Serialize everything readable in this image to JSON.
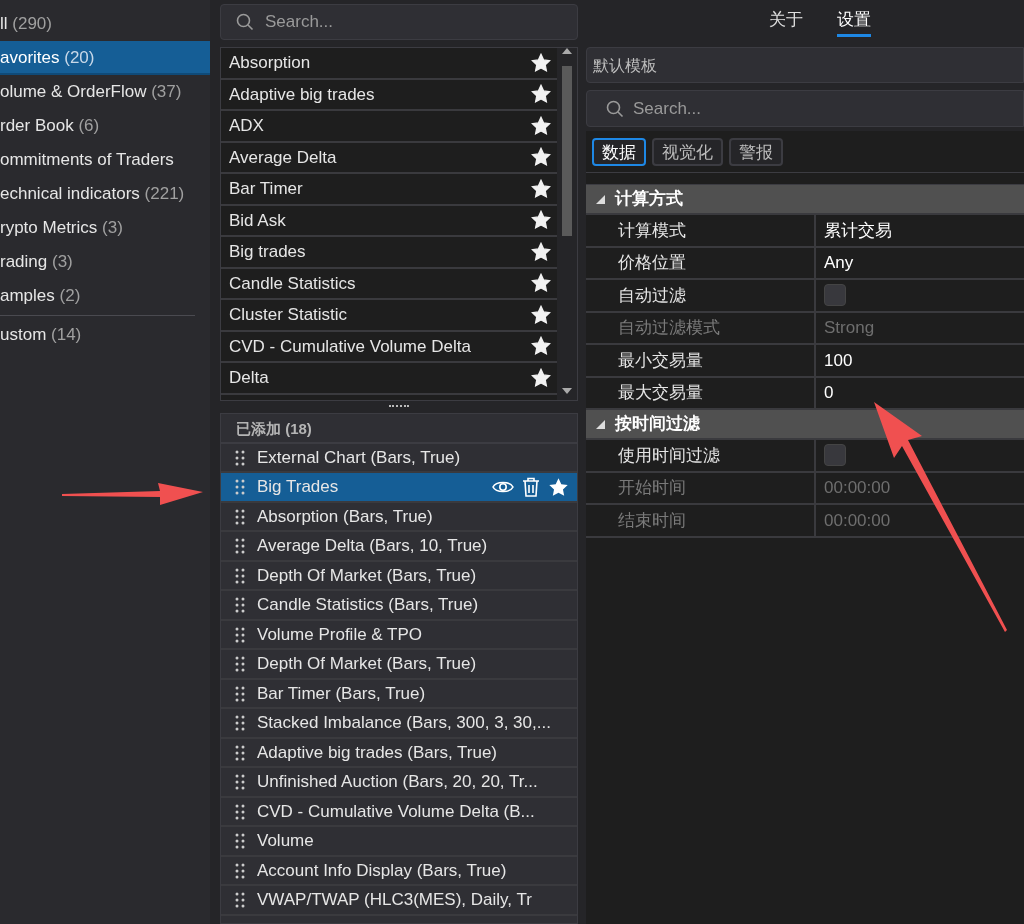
{
  "categories": [
    {
      "label": "ll",
      "count": "(290)",
      "selected": false
    },
    {
      "label": "avorites",
      "count": "(20)",
      "selected": true
    },
    {
      "label": "olume & OrderFlow",
      "count": "(37)",
      "selected": false
    },
    {
      "label": "rder Book",
      "count": "(6)",
      "selected": false
    },
    {
      "label": "ommitments of Traders",
      "selected": false
    },
    {
      "label": "echnical indicators",
      "count": "(221)",
      "selected": false
    },
    {
      "label": "rypto Metrics",
      "count": "(3)",
      "selected": false
    },
    {
      "label": "rading",
      "count": "(3)",
      "selected": false
    },
    {
      "label": "amples",
      "count": "(2)",
      "selected": false
    },
    {
      "label": "ustom",
      "count": "(14)",
      "selected": false
    }
  ],
  "indicator_search": {
    "placeholder": "Search..."
  },
  "indicators": [
    {
      "name": "Absorption",
      "favorite": true
    },
    {
      "name": "Adaptive big trades",
      "favorite": true
    },
    {
      "name": "ADX",
      "favorite": true
    },
    {
      "name": "Average Delta",
      "favorite": true
    },
    {
      "name": "Bar Timer",
      "favorite": true
    },
    {
      "name": "Bid Ask",
      "favorite": true
    },
    {
      "name": "Big trades",
      "favorite": true
    },
    {
      "name": "Candle Statistics",
      "favorite": true
    },
    {
      "name": "Cluster Statistic",
      "favorite": true
    },
    {
      "name": "CVD - Cumulative Volume Delta",
      "favorite": true
    },
    {
      "name": "Delta",
      "favorite": true
    }
  ],
  "added": {
    "title": "已添加 (18)",
    "items": [
      {
        "name": "External Chart (Bars, True)",
        "selected": false
      },
      {
        "name": "Big Trades",
        "selected": true
      },
      {
        "name": "Absorption (Bars, True)",
        "selected": false
      },
      {
        "name": "Average Delta (Bars, 10, True)",
        "selected": false
      },
      {
        "name": "Depth Of Market (Bars, True)",
        "selected": false
      },
      {
        "name": "Candle Statistics (Bars, True)",
        "selected": false
      },
      {
        "name": "Volume Profile & TPO",
        "selected": false
      },
      {
        "name": "Depth Of Market (Bars, True)",
        "selected": false
      },
      {
        "name": "Bar Timer (Bars, True)",
        "selected": false
      },
      {
        "name": "Stacked Imbalance (Bars, 300, 3, 30,...",
        "selected": false
      },
      {
        "name": "Adaptive big trades (Bars, True)",
        "selected": false
      },
      {
        "name": "Unfinished Auction (Bars, 20, 20, Tr...",
        "selected": false
      },
      {
        "name": "CVD - Cumulative Volume Delta (B...",
        "selected": false
      },
      {
        "name": "Volume",
        "selected": false
      },
      {
        "name": "Account Info Display (Bars, True)",
        "selected": false
      },
      {
        "name": "VWAP/TWAP (HLC3(MES), Daily, Tr",
        "selected": false
      }
    ]
  },
  "tabs": [
    {
      "label": "关于",
      "selected": false
    },
    {
      "label": "设置",
      "selected": true
    }
  ],
  "template": "默认模板",
  "settings_search": {
    "placeholder": "Search..."
  },
  "subtabs": [
    {
      "label": "数据",
      "selected": true
    },
    {
      "label": "视觉化",
      "selected": false
    },
    {
      "label": "警报",
      "selected": false
    }
  ],
  "sections": [
    {
      "title": "计算方式",
      "expanded": true,
      "rows": [
        {
          "label": "计算模式",
          "kind": "text",
          "value": "累计交易",
          "disabled": false
        },
        {
          "label": "价格位置",
          "kind": "text",
          "value": "Any",
          "disabled": false
        },
        {
          "label": "自动过滤",
          "kind": "checkbox",
          "checked": false,
          "disabled": false
        },
        {
          "label": "自动过滤模式",
          "kind": "text",
          "value": "Strong",
          "disabled": true
        },
        {
          "label": "最小交易量",
          "kind": "text",
          "value": "100",
          "disabled": false
        },
        {
          "label": "最大交易量",
          "kind": "text",
          "value": "0",
          "disabled": false
        }
      ]
    },
    {
      "title": "按时间过滤",
      "expanded": true,
      "rows": [
        {
          "label": "使用时间过滤",
          "kind": "checkbox",
          "checked": false,
          "disabled": false
        },
        {
          "label": "开始时间",
          "kind": "text",
          "value": "00:00:00",
          "disabled": true
        },
        {
          "label": "结束时间",
          "kind": "text",
          "value": "00:00:00",
          "disabled": true
        }
      ]
    }
  ]
}
